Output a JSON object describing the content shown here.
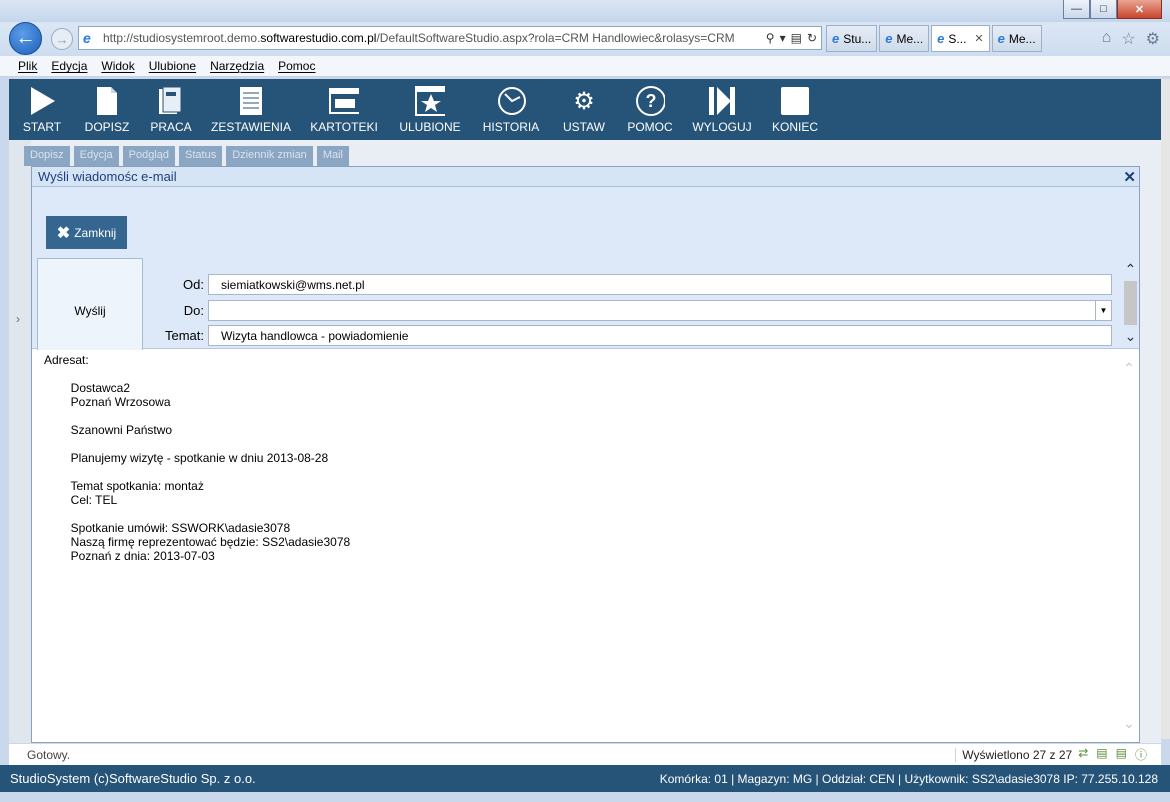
{
  "window": {
    "controls": {
      "minimize": "—",
      "maximize": "□",
      "close": "✕"
    }
  },
  "browser": {
    "url_prefix": "http://studiosystemroot.demo.",
    "url_domain": "softwarestudio.com.pl",
    "url_suffix": "/DefaultSoftwareStudio.aspx?rola=CRM Handlowiec&rolasys=CRM",
    "tabs": [
      {
        "label": "Stu...",
        "active": false
      },
      {
        "label": "Me...",
        "active": false
      },
      {
        "label": "S...",
        "active": true
      },
      {
        "label": "Me...",
        "active": false
      }
    ]
  },
  "menu": [
    "Plik",
    "Edycja",
    "Widok",
    "Ulubione",
    "Narzędzia",
    "Pomoc"
  ],
  "toolbar": [
    {
      "label": "START",
      "icon": "play-icon"
    },
    {
      "label": "DOPISZ",
      "icon": "document-icon"
    },
    {
      "label": "PRACA",
      "icon": "binder-icon"
    },
    {
      "label": "ZESTAWIENIA",
      "icon": "report-icon"
    },
    {
      "label": "KARTOTEKI",
      "icon": "window-icon"
    },
    {
      "label": "ULUBIONE",
      "icon": "star-icon"
    },
    {
      "label": "HISTORIA",
      "icon": "history-icon"
    },
    {
      "label": "USTAW",
      "icon": "gears-icon"
    },
    {
      "label": "POMOC",
      "icon": "help-icon"
    },
    {
      "label": "WYLOGUJ",
      "icon": "logout-icon"
    },
    {
      "label": "KONIEC",
      "icon": "stop-icon"
    }
  ],
  "subtoolbar": [
    "Dopisz",
    "Edycja",
    "Podgląd",
    "Status",
    "Dziennik zmian",
    "Mail"
  ],
  "dialog": {
    "title": "Wyśli wiadomośc e-mail",
    "close_label": "Zamknij",
    "send_label": "Wyślij",
    "fields": {
      "from_label": "Od:",
      "from_value": "siemiatkowski@wms.net.pl",
      "to_label": "Do:",
      "to_value": "",
      "subject_label": "Temat:",
      "subject_value": "Wizyta handlowca - powiadomienie"
    },
    "body": "Adresat:\n\n        Dostawca2\n        Poznań Wrzosowa\n\n        Szanowni Państwo\n\n        Planujemy wizytę - spotkanie w dniu 2013-08-28\n\n        Temat spotkania: montaż\n        Cel: TEL\n\n        Spotkanie umówił: SSWORK\\adasie3078\n        Naszą firmę reprezentować będzie: SS2\\adasie3078\n        Poznań z dnia: 2013-07-03"
  },
  "status": {
    "ready": "Gotowy.",
    "count": "Wyświetlono 27 z 27"
  },
  "footer": {
    "left": "StudioSystem (c)SoftwareStudio Sp. z o.o.",
    "right": "Komórka: 01 | Magazyn: MG | Oddział: CEN | Użytkownik: SS2\\adasie3078 IP: 77.255.10.128"
  },
  "colors": {
    "brand_dark": "#265378",
    "dialog_header": "#dde9f8",
    "button_blue": "#34668f"
  }
}
